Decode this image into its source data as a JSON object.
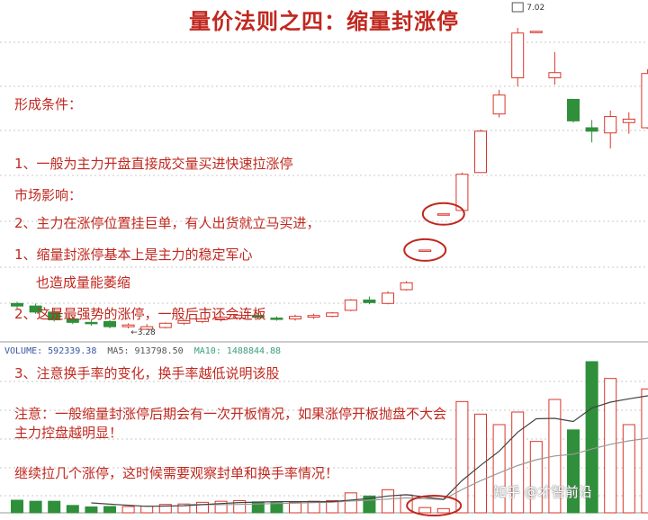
{
  "title": "量价法则之四：缩量封涨停",
  "notes": {
    "formation": {
      "heading": "形成条件：",
      "lines": [
        "1、一般为主力开盘直接成交量买进快速拉涨停",
        "2、主力在涨停位置挂巨单，有人出货就立马买进，",
        "     也造成量能萎缩"
      ]
    },
    "impact": {
      "heading": "市场影响：",
      "lines": [
        "1、缩量封涨停基本上是主力的稳定军心",
        "2、这是最强势的涨停，一般后市还会连板",
        "3、注意换手率的变化，换手率越低说明该股",
        "主力控盘越明显！"
      ]
    },
    "caution": {
      "lines": [
        "注意：一般缩量封涨停后期会有一次开板情况，如果涨停开板抛盘不大会",
        "继续拉几个涨停，这时候需要观察封单和换手率情况！"
      ]
    }
  },
  "volume_header": {
    "volume": "VOLUME: 592339.38",
    "ma5": "MA5: 913798.50",
    "ma10": "MA10: 1488844.88"
  },
  "price_labels": {
    "high": "7.02",
    "low": "3.28"
  },
  "watermark": "知乎 @才智前沿",
  "colors": {
    "up": "#d9362b",
    "down": "#2f8f3a",
    "text_red": "#c0281f",
    "ma5": "#444444",
    "ma10": "#999999",
    "volume_header": "#3a55a0",
    "ma_header": "#3aa07a"
  },
  "chart_data": [
    {
      "type": "candlestick",
      "series": [
        {
          "name": "",
          "ohlc": [
            [
              3.58,
              3.6,
              3.52,
              3.55
            ],
            [
              3.55,
              3.58,
              3.46,
              3.48
            ],
            [
              3.48,
              3.52,
              3.37,
              3.39
            ],
            [
              3.4,
              3.43,
              3.34,
              3.36
            ],
            [
              3.36,
              3.39,
              3.32,
              3.35
            ],
            [
              3.37,
              3.39,
              3.29,
              3.31
            ],
            [
              3.31,
              3.35,
              3.29,
              3.33
            ],
            [
              3.28,
              3.34,
              3.28,
              3.31
            ],
            [
              3.3,
              3.36,
              3.29,
              3.35
            ],
            [
              3.35,
              3.39,
              3.33,
              3.38
            ],
            [
              3.37,
              3.41,
              3.35,
              3.4
            ],
            [
              3.39,
              3.43,
              3.37,
              3.42
            ],
            [
              3.41,
              3.45,
              3.39,
              3.44
            ],
            [
              3.44,
              3.47,
              3.4,
              3.42
            ],
            [
              3.41,
              3.43,
              3.38,
              3.4
            ],
            [
              3.4,
              3.45,
              3.38,
              3.43
            ],
            [
              3.42,
              3.46,
              3.4,
              3.44
            ],
            [
              3.43,
              3.48,
              3.42,
              3.47
            ],
            [
              3.5,
              3.63,
              3.49,
              3.62
            ],
            [
              3.62,
              3.66,
              3.57,
              3.59
            ],
            [
              3.58,
              3.72,
              3.57,
              3.7
            ],
            [
              3.74,
              3.84,
              3.73,
              3.82
            ],
            [
              4.2,
              4.2,
              4.2,
              4.2
            ],
            [
              4.62,
              4.62,
              4.62,
              4.62
            ],
            [
              4.66,
              5.1,
              4.66,
              5.08
            ],
            [
              5.1,
              5.6,
              5.1,
              5.58
            ],
            [
              5.78,
              6.06,
              5.74,
              6.0
            ],
            [
              6.2,
              6.78,
              6.1,
              6.72
            ],
            [
              6.74,
              6.74,
              6.74,
              6.74
            ],
            [
              6.2,
              6.5,
              6.12,
              6.26
            ],
            [
              5.95,
              5.95,
              5.68,
              5.7
            ],
            [
              5.62,
              5.71,
              5.45,
              5.58
            ],
            [
              5.56,
              5.82,
              5.38,
              5.75
            ],
            [
              5.68,
              5.8,
              5.55,
              5.72
            ],
            [
              5.62,
              6.3,
              5.61,
              6.25
            ],
            [
              6.18,
              6.3,
              6.08,
              6.12
            ]
          ]
        }
      ]
    },
    {
      "type": "bar",
      "series": [
        {
          "name": "VOLUME",
          "values": [
            60,
            55,
            55,
            35,
            28,
            30,
            30,
            32,
            40,
            42,
            50,
            55,
            58,
            52,
            48,
            50,
            55,
            58,
            95,
            80,
            110,
            85,
            25,
            20,
            530,
            470,
            420,
            480,
            340,
            540,
            395,
            720,
            640,
            420,
            590,
            500
          ]
        },
        {
          "name": "MA5",
          "values": [
            null,
            null,
            null,
            null,
            47,
            41,
            36,
            31,
            32,
            34,
            39,
            44,
            49,
            51,
            53,
            53,
            53,
            53,
            61,
            68,
            80,
            86,
            75,
            64,
            154,
            226,
            293,
            384,
            448,
            450,
            435,
            499,
            527,
            543,
            557,
            573
          ]
        },
        {
          "name": "MA10",
          "values": [
            null,
            null,
            null,
            null,
            null,
            null,
            null,
            null,
            null,
            40,
            39,
            39,
            40,
            42,
            44,
            46,
            49,
            51,
            56,
            60,
            65,
            71,
            67,
            63,
            111,
            153,
            190,
            225,
            253,
            271,
            279,
            304,
            326,
            343,
            355,
            398
          ]
        }
      ]
    }
  ]
}
